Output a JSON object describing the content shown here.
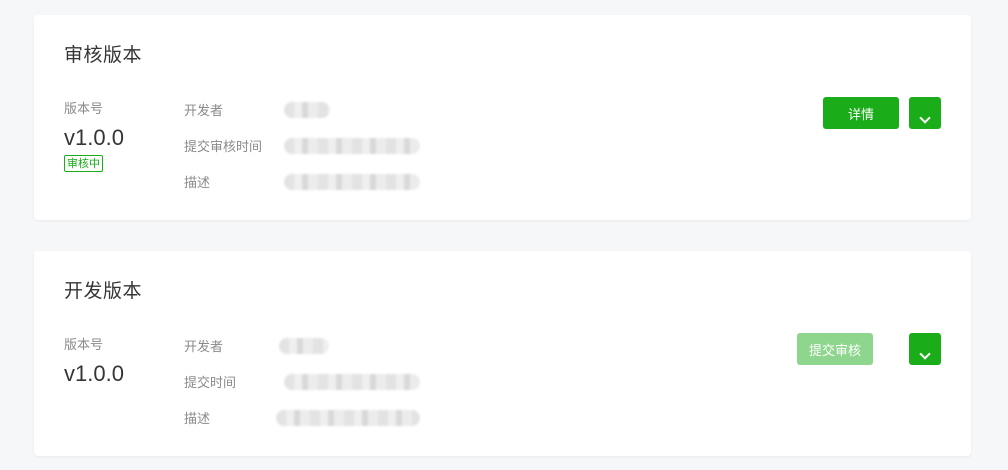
{
  "review_card": {
    "title": "审核版本",
    "version_label": "版本号",
    "version_value": "v1.0.0",
    "status": "审核中",
    "fields": [
      {
        "label": "开发者"
      },
      {
        "label": "提交审核时间"
      },
      {
        "label": "描述"
      }
    ],
    "primary_button": "详情",
    "dropdown_icon": "chevron-down-icon"
  },
  "dev_card": {
    "title": "开发版本",
    "version_label": "版本号",
    "version_value": "v1.0.0",
    "fields": [
      {
        "label": "开发者"
      },
      {
        "label": "提交时间"
      },
      {
        "label": "描述"
      }
    ],
    "primary_button": "提交审核",
    "primary_button_disabled": true,
    "dropdown_icon": "chevron-down-icon"
  },
  "colors": {
    "brand_green": "#1aad19",
    "disabled_green": "#8ed68d",
    "page_background": "#f6f7f9"
  }
}
